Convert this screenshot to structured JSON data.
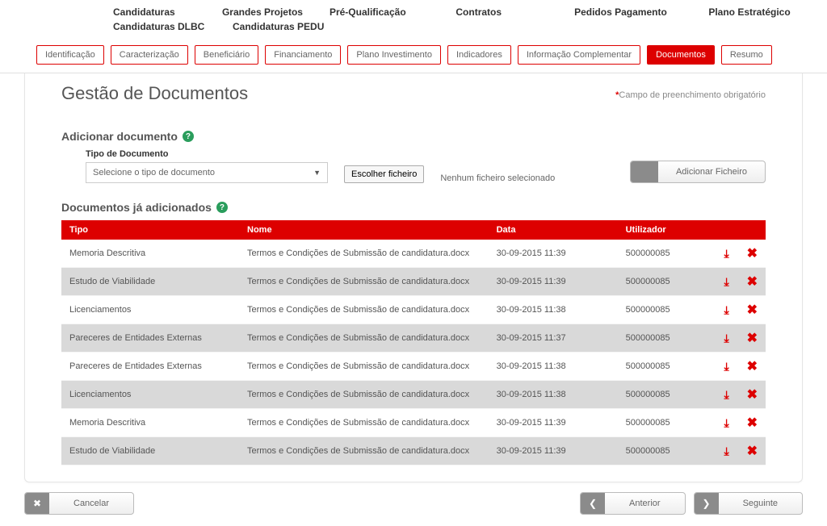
{
  "topnav": {
    "row1": [
      "Candidaturas",
      "Grandes Projetos",
      "Pré-Qualificação",
      "Contratos",
      "Pedidos Pagamento",
      "Plano Estratégico"
    ],
    "row2": [
      "Candidaturas DLBC",
      "Candidaturas PEDU"
    ]
  },
  "tabs": [
    "Identificação",
    "Caracterização",
    "Beneficiário",
    "Financiamento",
    "Plano Investimento",
    "Indicadores",
    "Informação Complementar",
    "Documentos",
    "Resumo"
  ],
  "active_tab": "Documentos",
  "title": "Gestão de Documentos",
  "required_note": "Campo de preenchimento obrigatório",
  "add_section": {
    "heading": "Adicionar documento",
    "type_label": "Tipo de Documento",
    "type_placeholder": "Selecione o tipo de documento",
    "pick_button": "Escolher ficheiro",
    "no_file": "Nenhum ficheiro selecionado",
    "add_button": "Adicionar Ficheiro"
  },
  "existing_heading": "Documentos já adicionados",
  "table": {
    "headers": {
      "tipo": "Tipo",
      "nome": "Nome",
      "data": "Data",
      "user": "Utilizador"
    },
    "rows": [
      {
        "tipo": "Memoria Descritiva",
        "nome": "Termos e Condições de Submissão de candidatura.docx",
        "data": "30-09-2015 11:39",
        "user": "500000085"
      },
      {
        "tipo": "Estudo de Viabilidade",
        "nome": "Termos e Condições de Submissão de candidatura.docx",
        "data": "30-09-2015 11:39",
        "user": "500000085"
      },
      {
        "tipo": "Licenciamentos",
        "nome": "Termos e Condições de Submissão de candidatura.docx",
        "data": "30-09-2015 11:38",
        "user": "500000085"
      },
      {
        "tipo": "Pareceres de Entidades Externas",
        "nome": "Termos e Condições de Submissão de candidatura.docx",
        "data": "30-09-2015 11:37",
        "user": "500000085"
      },
      {
        "tipo": "Pareceres de Entidades Externas",
        "nome": "Termos e Condições de Submissão de candidatura.docx",
        "data": "30-09-2015 11:38",
        "user": "500000085"
      },
      {
        "tipo": "Licenciamentos",
        "nome": "Termos e Condições de Submissão de candidatura.docx",
        "data": "30-09-2015 11:38",
        "user": "500000085"
      },
      {
        "tipo": "Memoria Descritiva",
        "nome": "Termos e Condições de Submissão de candidatura.docx",
        "data": "30-09-2015 11:39",
        "user": "500000085"
      },
      {
        "tipo": "Estudo de Viabilidade",
        "nome": "Termos e Condições de Submissão de candidatura.docx",
        "data": "30-09-2015 11:39",
        "user": "500000085"
      }
    ]
  },
  "footer": {
    "cancel": "Cancelar",
    "prev": "Anterior",
    "next": "Seguinte"
  }
}
